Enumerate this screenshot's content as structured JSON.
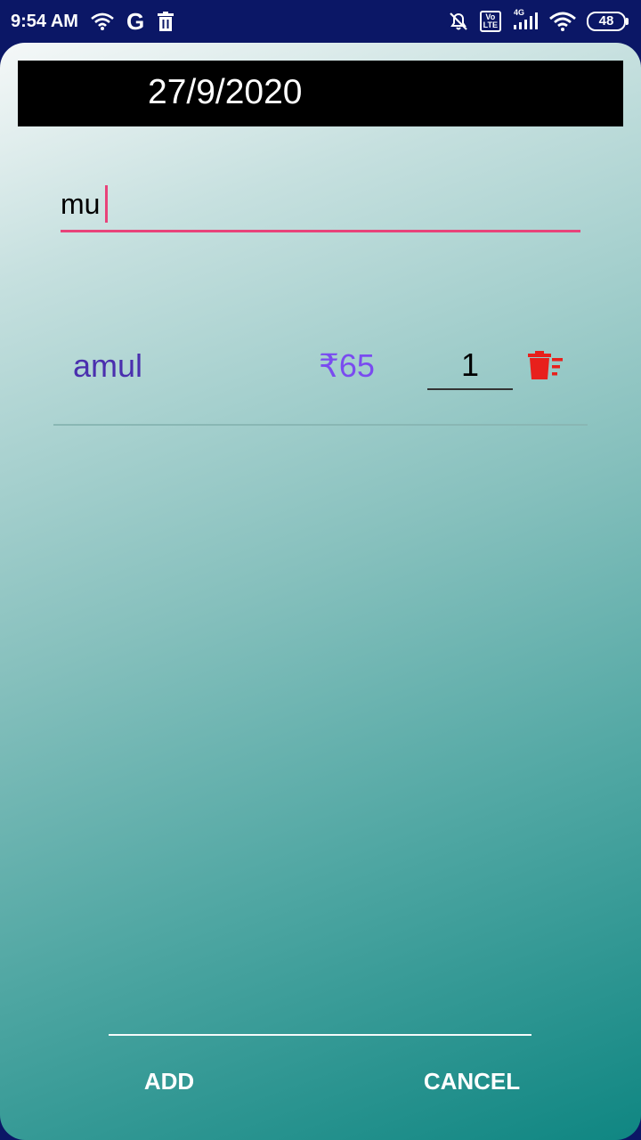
{
  "status_bar": {
    "time": "9:54 AM",
    "network_badge": "4G",
    "volte_label": "Vo\nLTE",
    "battery": "48"
  },
  "colors": {
    "accent": "#e8437a",
    "product_name": "#4a2fae",
    "price": "#7a4bf0",
    "delete": "#e8201c",
    "status_bar": "#0b1766"
  },
  "header": {
    "date": "27/9/2020"
  },
  "search": {
    "value": "mu",
    "placeholder": ""
  },
  "items": [
    {
      "name": "amul",
      "price": "₹65",
      "quantity": "1",
      "delete_icon": "delete-sweep-icon"
    }
  ],
  "actions": {
    "add_label": "ADD",
    "cancel_label": "CANCEL"
  }
}
